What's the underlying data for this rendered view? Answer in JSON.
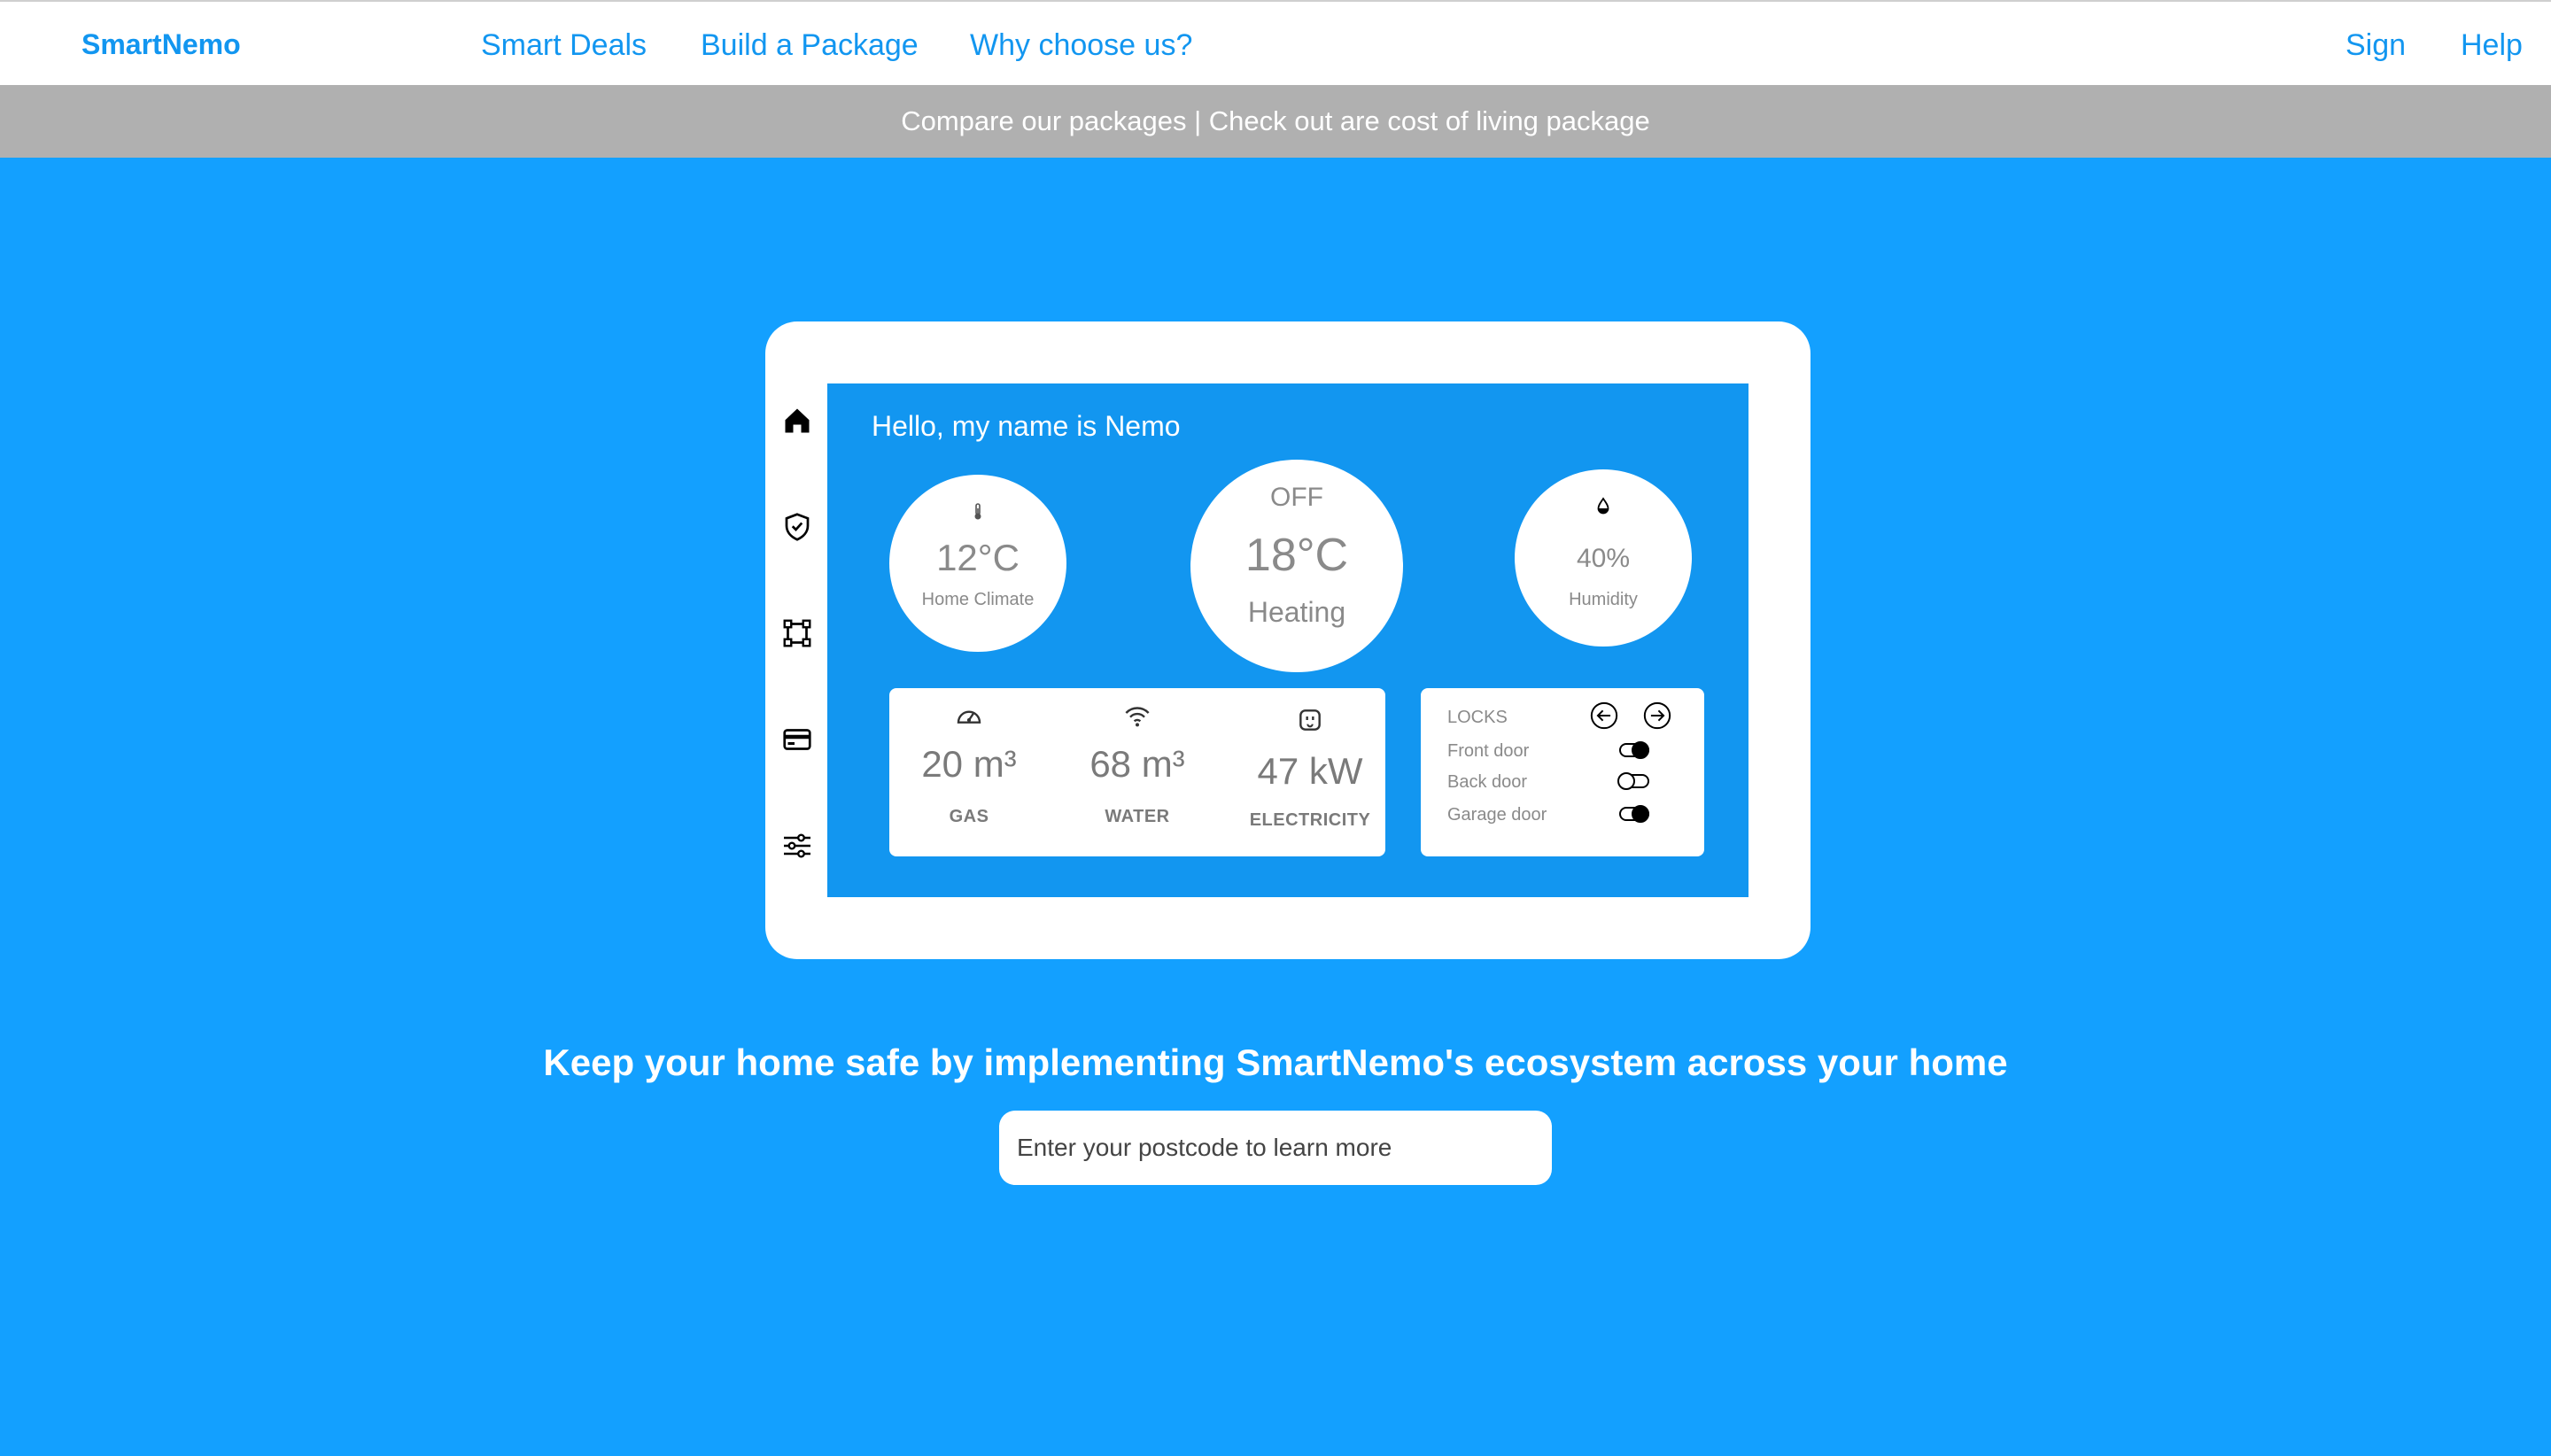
{
  "nav": {
    "brand": "SmartNemo",
    "links": [
      "Smart Deals",
      "Build a Package",
      "Why choose us?"
    ],
    "right_links": [
      "Sign",
      "Help"
    ]
  },
  "banner": {
    "text": "Compare our packages | Check out are cost of living package"
  },
  "device": {
    "greeting": "Hello, my name is Nemo",
    "sidebar_icons": [
      "home-icon",
      "shield-check-icon",
      "frame-icon",
      "card-icon",
      "sliders-icon"
    ],
    "climate": {
      "icon": "thermometer-icon",
      "value": "12°C",
      "label": "Home Climate"
    },
    "heating": {
      "status": "OFF",
      "value": "18°C",
      "label": "Heating"
    },
    "humidity": {
      "icon": "droplet-icon",
      "value": "40%",
      "label": "Humidity"
    },
    "meters": [
      {
        "icon": "gauge-icon",
        "value": "20 m³",
        "label": "GAS"
      },
      {
        "icon": "wifi-icon",
        "value": "68 m³",
        "label": "WATER"
      },
      {
        "icon": "plug-icon",
        "value": "47 kW",
        "label": "ELECTRICITY"
      }
    ],
    "locks": {
      "title": "LOCKS",
      "items": [
        {
          "label": "Front door",
          "on": true
        },
        {
          "label": "Back door",
          "on": false
        },
        {
          "label": "Garage door",
          "on": true
        }
      ]
    }
  },
  "hero": {
    "headline": "Keep your home safe by implementing SmartNemo's ecosystem across your home",
    "postcode_placeholder": "Enter your postcode to learn more"
  },
  "colors": {
    "brand": "#1296f0",
    "page_background": "#13a0ff",
    "banner": "#b0b0b0"
  }
}
